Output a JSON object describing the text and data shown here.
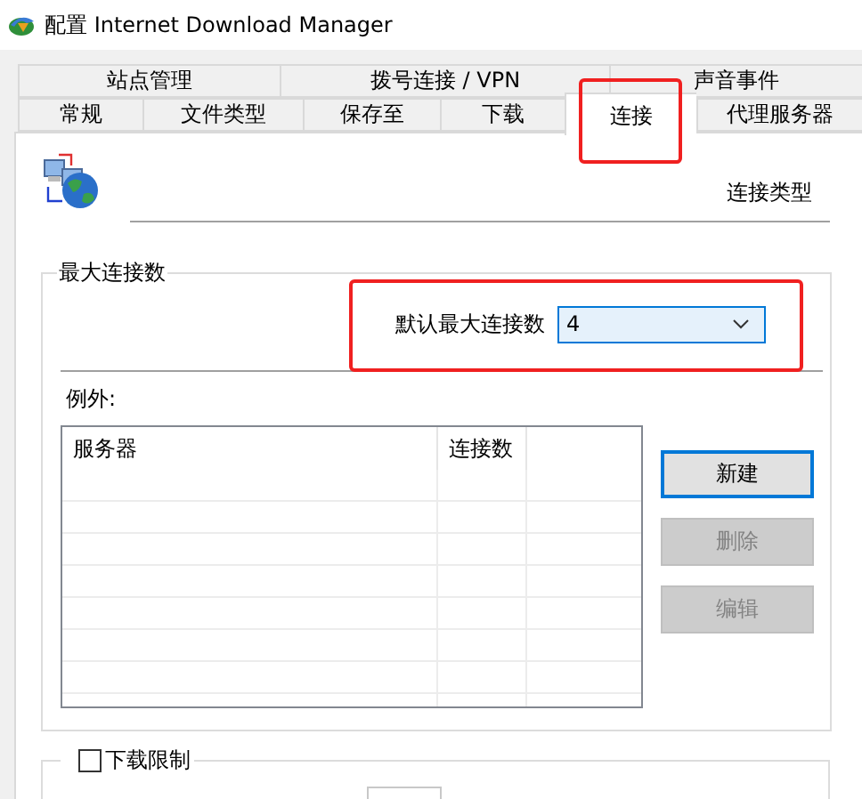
{
  "window": {
    "title": "配置 Internet Download Manager"
  },
  "tab_rows": [
    [
      {
        "label": "站点管理",
        "selected": false,
        "highlighted": false
      },
      {
        "label": "拨号连接 / VPN",
        "selected": false,
        "highlighted": false
      },
      {
        "label": "声音事件",
        "selected": false,
        "highlighted": false
      }
    ],
    [
      {
        "label": "常规",
        "selected": false,
        "highlighted": false
      },
      {
        "label": "文件类型",
        "selected": false,
        "highlighted": false
      },
      {
        "label": "保存至",
        "selected": false,
        "highlighted": false
      },
      {
        "label": "下载",
        "selected": false,
        "highlighted": false
      },
      {
        "label": "连接",
        "selected": true,
        "highlighted": true
      },
      {
        "label": "代理服务器",
        "selected": false,
        "highlighted": false
      }
    ]
  ],
  "page": {
    "heading": "连接类型"
  },
  "max_connections": {
    "title": "最大连接数",
    "default_label": "默认最大连接数",
    "default_value": "4",
    "highlighted": true,
    "exceptions_label": "例外:",
    "columns": [
      "服务器",
      "连接数"
    ],
    "buttons": [
      {
        "label": "新建",
        "disabled": false,
        "focused": true
      },
      {
        "label": "删除",
        "disabled": true,
        "focused": false
      },
      {
        "label": "编辑",
        "disabled": true,
        "focused": false
      }
    ]
  },
  "download_limit": {
    "label": "下载限制",
    "checked": false
  }
}
